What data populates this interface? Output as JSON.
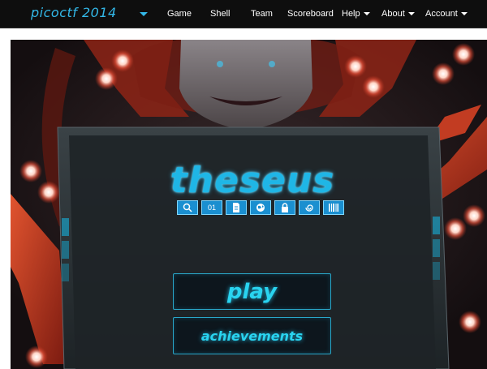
{
  "navbar": {
    "brand": "picoctf 2014",
    "items": [
      {
        "label": "Game",
        "dropdown": false
      },
      {
        "label": "Shell",
        "dropdown": false
      },
      {
        "label": "Team",
        "dropdown": false
      },
      {
        "label": "Scoreboard",
        "dropdown": false
      },
      {
        "label": "Help",
        "dropdown": true
      },
      {
        "label": "About",
        "dropdown": true
      },
      {
        "label": "Account",
        "dropdown": true
      }
    ]
  },
  "game": {
    "title": "theseus",
    "icons": [
      {
        "name": "magnifier-icon",
        "glyph": ""
      },
      {
        "name": "binary-icon",
        "glyph": "01"
      },
      {
        "name": "document-icon",
        "glyph": ""
      },
      {
        "name": "globe-icon",
        "glyph": ""
      },
      {
        "name": "lock-icon",
        "glyph": ""
      },
      {
        "name": "swirl-icon",
        "glyph": ""
      },
      {
        "name": "barcode-icon",
        "glyph": ""
      }
    ],
    "menu": {
      "play_label": "play",
      "achievements_label": "achievements"
    }
  },
  "colors": {
    "brand": "#33b8e8",
    "neon": "#29d4f0",
    "robot_red": "#b8321e"
  }
}
